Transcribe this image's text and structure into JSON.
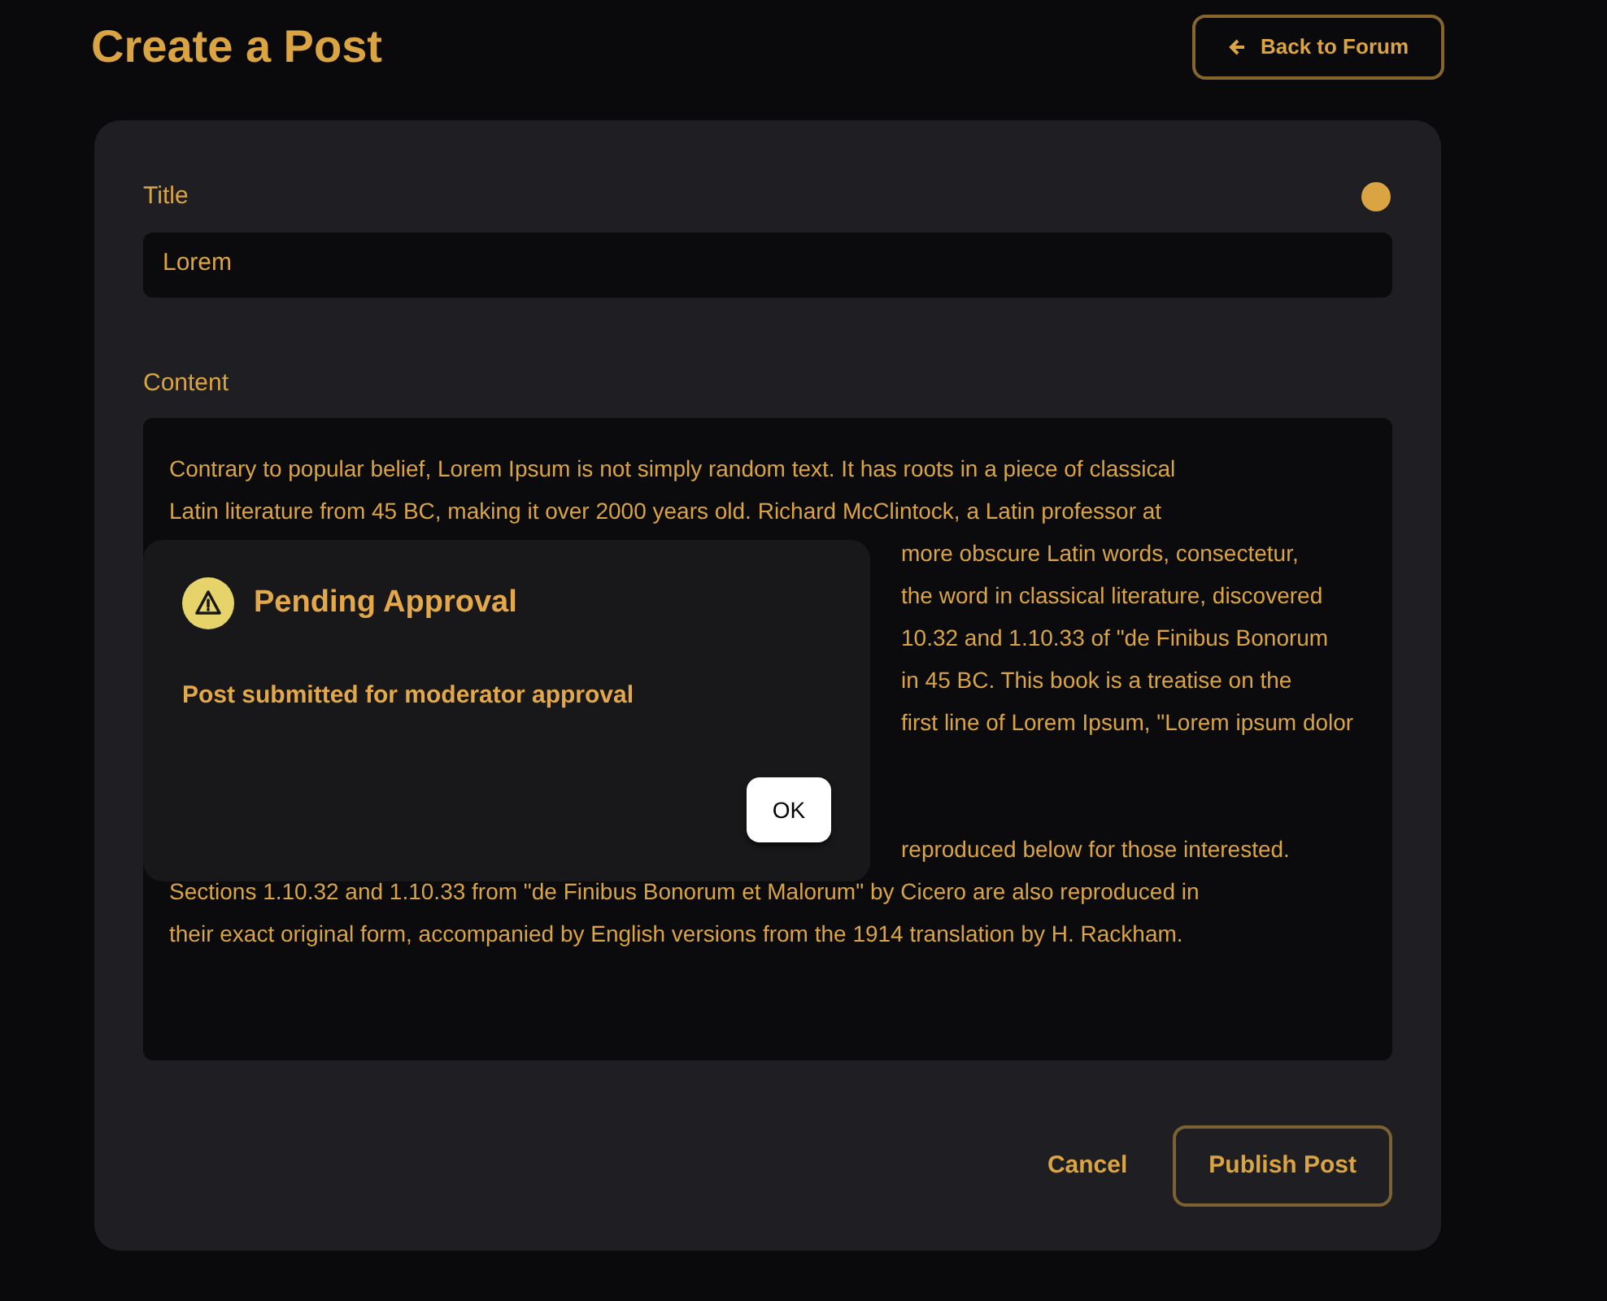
{
  "page": {
    "title": "Create a Post",
    "back_button": "Back to Forum"
  },
  "form": {
    "title_label": "Title",
    "title_value": "Lorem",
    "content_label": "Content",
    "content_lines": [
      {
        "kind": "full",
        "text": "Contrary to popular belief, Lorem Ipsum is not simply random text. It has roots in a piece of classical"
      },
      {
        "kind": "full",
        "text": "Latin literature from 45 BC, making it over 2000 years old. Richard McClintock, a Latin professor at"
      },
      {
        "kind": "partial",
        "text": "more obscure Latin words, consectetur,"
      },
      {
        "kind": "partial",
        "text": "the word in classical literature, discovered"
      },
      {
        "kind": "partial",
        "text": "10.32 and 1.10.33 of \"de Finibus Bonorum"
      },
      {
        "kind": "partial",
        "text": "in 45 BC. This book is a treatise on the"
      },
      {
        "kind": "partial",
        "text": "first line of Lorem Ipsum, \"Lorem ipsum dolor"
      },
      {
        "kind": "gap"
      },
      {
        "kind": "gap"
      },
      {
        "kind": "partial",
        "text": "reproduced below for those interested."
      },
      {
        "kind": "full",
        "text": "Sections 1.10.32 and 1.10.33 from \"de Finibus Bonorum et Malorum\" by Cicero are also reproduced in"
      },
      {
        "kind": "full",
        "text": "their exact original form, accompanied by English versions from the 1914 translation by H. Rackham."
      }
    ],
    "buttons": [
      {
        "kind": "text",
        "label": "Cancel"
      },
      {
        "kind": "outlined",
        "label": "Publish Post"
      }
    ]
  },
  "dialog": {
    "title": "Pending Approval",
    "message": "Post submitted for moderator approval",
    "button": "OK"
  }
}
